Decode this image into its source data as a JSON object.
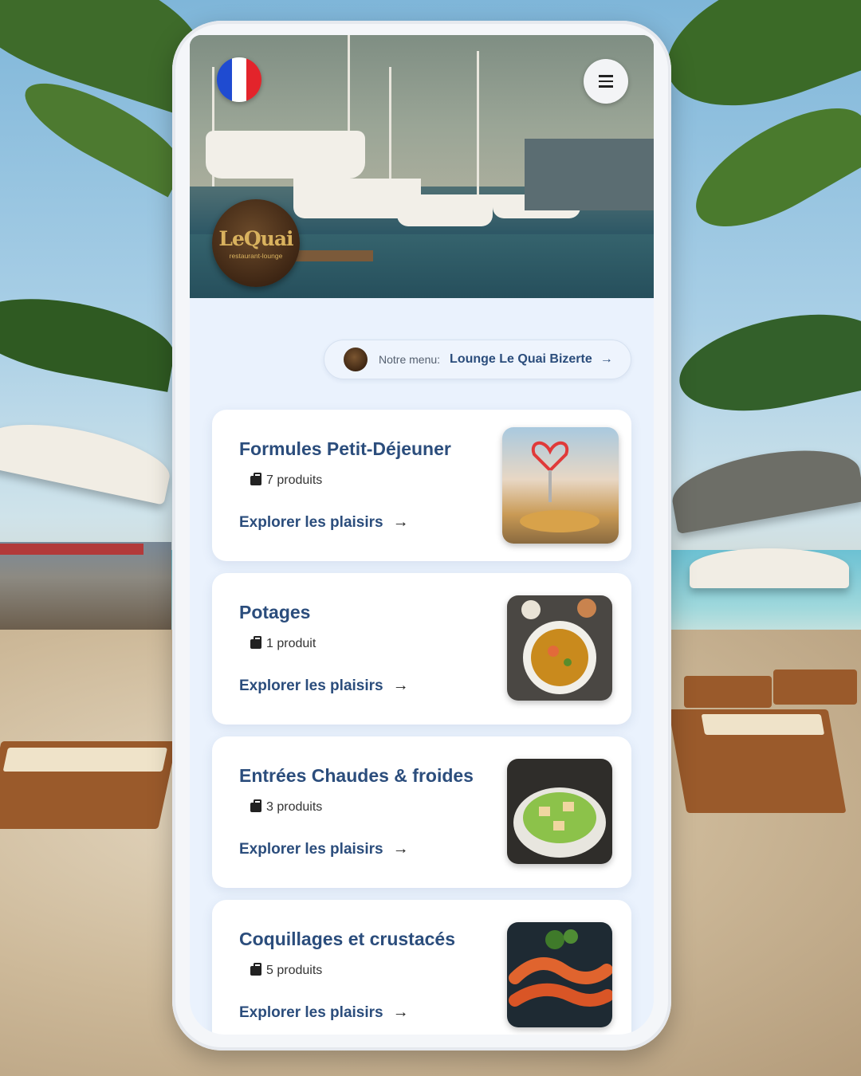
{
  "header": {
    "flag_icon": "france-flag-icon",
    "menu_icon": "hamburger-menu-icon",
    "logo": {
      "name": "LeQuai",
      "subtitle": "restaurant-lounge"
    }
  },
  "notre_menu": {
    "label": "Notre menu:",
    "value": "Lounge Le Quai Bizerte",
    "arrow": "→"
  },
  "categories": [
    {
      "title": "Formules Petit-Déjeuner",
      "count": "7 produits",
      "link": "Explorer les plaisirs",
      "arrow": "→"
    },
    {
      "title": "Potages",
      "count": "1 produit",
      "link": "Explorer les plaisirs",
      "arrow": "→"
    },
    {
      "title": "Entrées Chaudes & froides",
      "count": "3 produits",
      "link": "Explorer les plaisirs",
      "arrow": "→"
    },
    {
      "title": "Coquillages et crustacés",
      "count": "5 produits",
      "link": "Explorer les plaisirs",
      "arrow": "→"
    }
  ],
  "colors": {
    "accent": "#2b4d7c",
    "card_bg": "#ffffff",
    "screen_bg": "#eaf2fd"
  }
}
